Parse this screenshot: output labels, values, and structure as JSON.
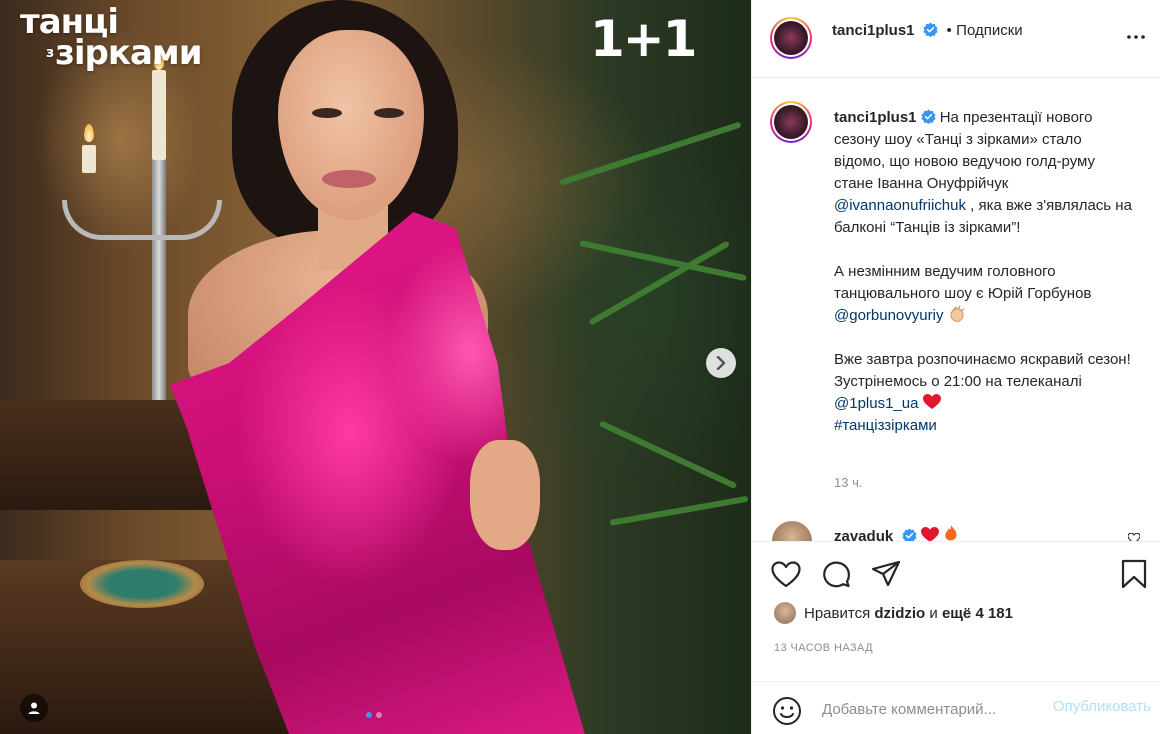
{
  "media": {
    "show_title_line1": "танці",
    "show_title_small": "з",
    "show_title_line2": "зірками",
    "channel_logo": "1+1",
    "next_icon": "chevron-right-icon",
    "carousel": {
      "count": 2,
      "active": 1
    }
  },
  "header": {
    "username": "tanci1plus1",
    "separator": "•",
    "follow_state": "Подписки",
    "more_icon": "more-horizontal-icon"
  },
  "caption": {
    "username": "tanci1plus1",
    "p1_a": "На презентації нового сезону шоу «Танці з зірками» стало відомо, що новою ведучою голд-руму стане Іванна Онуфрійчук",
    "p1_mention": "@ivannaonufriichuk",
    "p1_b": ", яка вже з'являлась на балконі “Танців із зірками”!",
    "p2_a": "А незмінним ведучим головного танцювального шоу є Юрій Горбунов",
    "p2_mention": "@gorbunovyuriy",
    "p3_a": "Вже завтра розпочинаємо яскравий сезон! Зустрінемось о 21:00 на телеканалі",
    "p3_mention": "@1plus1_ua",
    "p3_hashtag": "#танціззірками",
    "time_ago": "13 ч."
  },
  "comment_preview": {
    "username": "zavaduk"
  },
  "actions": {
    "like_icon": "heart-icon",
    "comment_icon": "comment-bubble-icon",
    "share_icon": "paper-plane-icon",
    "save_icon": "bookmark-icon"
  },
  "likes": {
    "prefix": "Нравится",
    "user": "dzidzio",
    "conj": "и",
    "rest": "ещё 4 181"
  },
  "timestamp": "13 ЧАСОВ НАЗАД",
  "add_comment": {
    "placeholder": "Добавьте комментарий...",
    "publish_label": "Опубликовать"
  },
  "colors": {
    "link": "#00376b",
    "verified": "#3897f0",
    "publish_disabled": "#b2dffc",
    "dress": "#e8188a"
  }
}
